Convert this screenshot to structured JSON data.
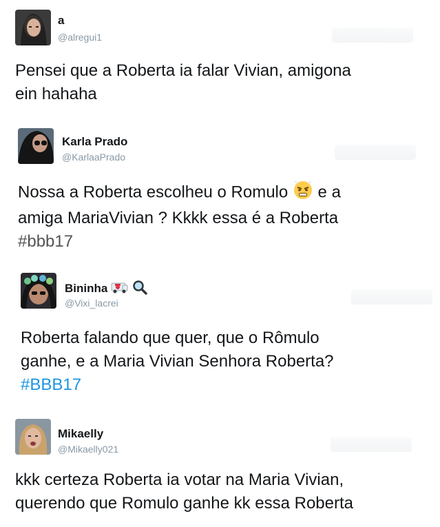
{
  "tweets": [
    {
      "name": "a",
      "handle": "@alregui1",
      "text": "Pensei que a Roberta ia falar Vivian, amigona\nein hahaha",
      "hashtag": ""
    },
    {
      "name": "Karla Prado",
      "handle": "@KarlaaPrado",
      "text_part1": "Nossa a Roberta escolheu o Romulo ",
      "emoji": "angry-face-emoji",
      "text_part2": " e a\namiga MariaVivian ? Kkkk essa é a Roberta\n",
      "hashtag": "#bbb17"
    },
    {
      "name": "Bininha",
      "name_emojis": [
        "ambulance-emoji",
        "magnifier-emoji"
      ],
      "handle": "@Vixi_lacrei",
      "text": "Roberta falando que quer, que o Rômulo\nganhe, e a Maria Vivian Senhora Roberta?\n",
      "hashtag": "#BBB17"
    },
    {
      "name": "Mikaelly",
      "handle": "@Mikaelly021",
      "text": "kkk certeza Roberta ia votar na Maria Vivian,\nquerendo que Romulo ganhe kk essa Roberta",
      "hashtag": ""
    }
  ],
  "colors": {
    "handle": "#8899a6",
    "hashtag_gray": "#555555",
    "hashtag_blue": "#1b95e0"
  }
}
